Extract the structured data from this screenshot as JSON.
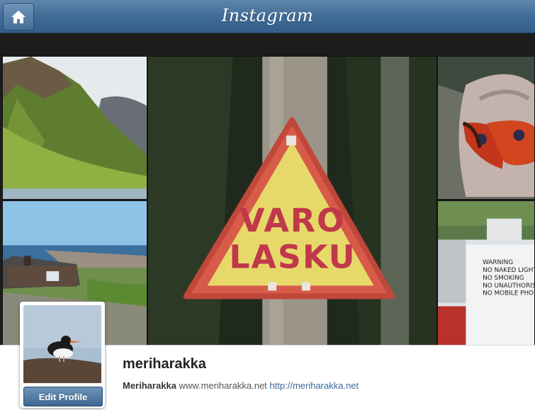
{
  "header": {
    "logo": "Instagram",
    "home_icon": "home-icon"
  },
  "grid": {
    "sign_line1": "VARO",
    "sign_line2": "LASKU",
    "warning_sign_lines": [
      "WARNING",
      "NO NAKED LIGHTS",
      "NO SMOKING",
      "NO UNAUTHORISED",
      "NO MOBILE PHONE"
    ]
  },
  "profile": {
    "username": "meriharakka",
    "full_name": "Meriharakka",
    "bio_text": "www.meriharakka.net",
    "website": "http://meriharakka.net",
    "edit_label": "Edit Profile"
  },
  "colors": {
    "header_blue": "#3f6a95",
    "link_blue": "#3a6a9c"
  }
}
